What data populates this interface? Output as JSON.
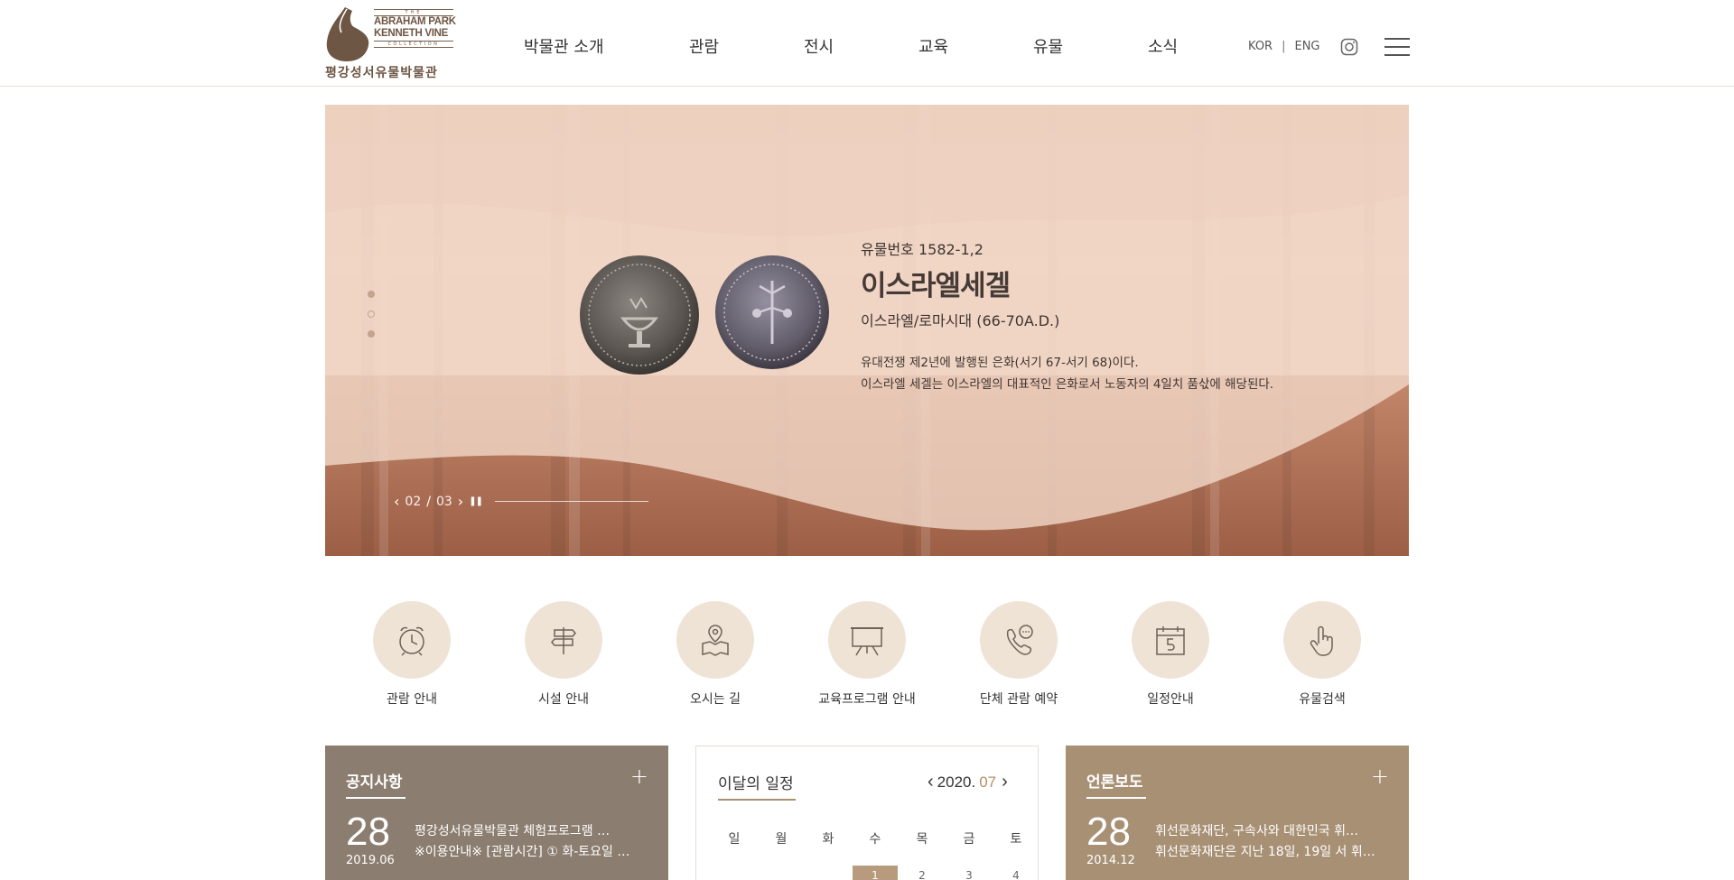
{
  "header": {
    "logo": {
      "the": "THE",
      "line1": "ABRAHAM PARK",
      "line2": "KENNETH VINE",
      "collection": "COLLECTION",
      "korean": "평강성서유물박물관"
    },
    "nav": [
      "박물관 소개",
      "관람",
      "전시",
      "교육",
      "유물",
      "소식"
    ],
    "lang_kor": "KOR",
    "lang_sep": "|",
    "lang_eng": "ENG",
    "instagram_icon": "instagram-icon",
    "menu_icon": "hamburger-icon"
  },
  "hero": {
    "artifact_number": "유물번호 1582-1,2",
    "title": "이스라엘세겔",
    "era": "이스라엘/로마시대 (66-70A.D.)",
    "desc_line1": "유대전쟁 제2년에 발행된 은화(서기 67-서기 68)이다.",
    "desc_line2": "이스라엘 세겔는 이스라엘의 대표적인 은화로서 노동자의 4일치 품삯에 해당된다.",
    "slide_current": "02",
    "slide_sep": "/",
    "slide_total": "03",
    "prev": "‹",
    "next": "›",
    "pause": "❚❚"
  },
  "quick_links": [
    {
      "label": "관람 안내",
      "icon": "clock-icon"
    },
    {
      "label": "시설 안내",
      "icon": "signpost-icon"
    },
    {
      "label": "오시는 길",
      "icon": "map-pin-icon"
    },
    {
      "label": "교육프로그램 안내",
      "icon": "presentation-board-icon"
    },
    {
      "label": "단체 관람 예약",
      "icon": "phone-chat-icon"
    },
    {
      "label": "일정안내",
      "icon": "calendar-icon"
    },
    {
      "label": "유물검색",
      "icon": "pointer-hand-icon"
    }
  ],
  "notice": {
    "title": "공지사항",
    "plus": "+",
    "day": "28",
    "ym": "2019.06",
    "line1": "평강성서유물박물관 체험프로그램 …",
    "line2": "※이용안내※ [관람시간] ① 화-토요일 …"
  },
  "calendar": {
    "title": "이달의 일정",
    "year": "2020.",
    "month": "07",
    "weekdays": [
      "일",
      "월",
      "화",
      "수",
      "목",
      "금",
      "토"
    ],
    "days": [
      "",
      "",
      "",
      "1",
      "2",
      "3",
      "4"
    ],
    "today": "1",
    "prev": "‹",
    "next": "›"
  },
  "press": {
    "title": "언론보도",
    "plus": "+",
    "day": "28",
    "ym": "2014.12",
    "line1": "휘선문화재단, 구속사와 대한민국 휘…",
    "line2": "휘선문화재단은 지난 18일, 19일 서 휘…"
  },
  "colors": {
    "brand": "#6e5644",
    "accent": "#b58f62",
    "notice_bg": "#8b7d6f",
    "press_bg": "#a89075",
    "quick_circle": "#efe3d6"
  }
}
